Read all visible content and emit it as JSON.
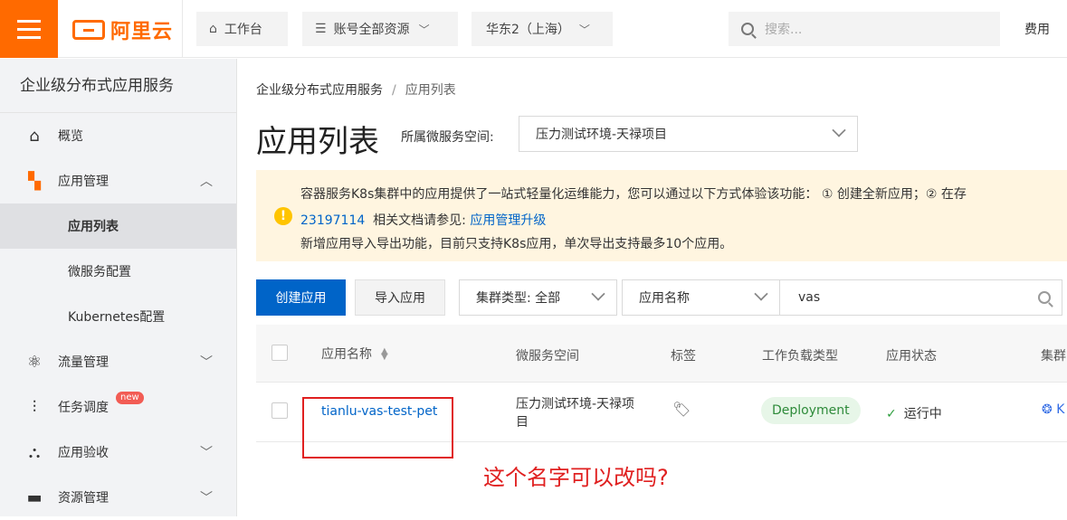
{
  "topbar": {
    "logo_text": "阿里云",
    "workbench": "工作台",
    "resources": "账号全部资源",
    "region": "华东2（上海）",
    "search_placeholder": "搜索...",
    "fee": "费用",
    "brand_color": "#ff6a00"
  },
  "sidebar": {
    "title": "企业级分布式应用服务",
    "items": [
      {
        "label": "概览",
        "icon": "home-icon"
      },
      {
        "label": "应用管理",
        "icon": "apps-icon",
        "expanded": true
      },
      {
        "label": "应用列表",
        "active": true
      },
      {
        "label": "微服务配置"
      },
      {
        "label": "Kubernetes配置"
      },
      {
        "label": "流量管理",
        "icon": "traffic-icon"
      },
      {
        "label": "任务调度",
        "icon": "sliders-icon",
        "badge": "new"
      },
      {
        "label": "应用验收",
        "icon": "network-icon"
      },
      {
        "label": "资源管理",
        "icon": "folder-icon"
      }
    ]
  },
  "breadcrumb": {
    "root": "企业级分布式应用服务",
    "sep": "/",
    "current": "应用列表"
  },
  "page": {
    "title": "应用列表",
    "namespace_label": "所属微服务空间:",
    "namespace_value": "压力测试环境-天禄项目"
  },
  "notice": {
    "line1": "容器服务K8s集群中的应用提供了一站式轻量化运维能力，您可以通过以下方式体验该功能： ① 创建全新应用；② 在存",
    "line2_link": "23197114",
    "line2_text": "相关文档请参见:",
    "line2_doc_link": "应用管理升级",
    "line3": "新增应用导入导出功能，目前只支持K8s应用，单次导出支持最多10个应用。"
  },
  "toolbar": {
    "create": "创建应用",
    "import": "导入应用",
    "cluster_type": "集群类型: 全部",
    "search_field": "应用名称",
    "search_value": "vas"
  },
  "table": {
    "headers": [
      "应用名称",
      "微服务空间",
      "标签",
      "工作负载类型",
      "应用状态",
      "集群"
    ],
    "rows": [
      {
        "name": "tianlu-vas-test-pet",
        "namespace_line1": "压力测试环境-天禄项",
        "namespace_line2": "目",
        "workload": "Deployment",
        "status": "运行中",
        "cluster": "K"
      }
    ]
  },
  "annotation": {
    "text": "这个名字可以改吗?",
    "color": "#e02020"
  }
}
